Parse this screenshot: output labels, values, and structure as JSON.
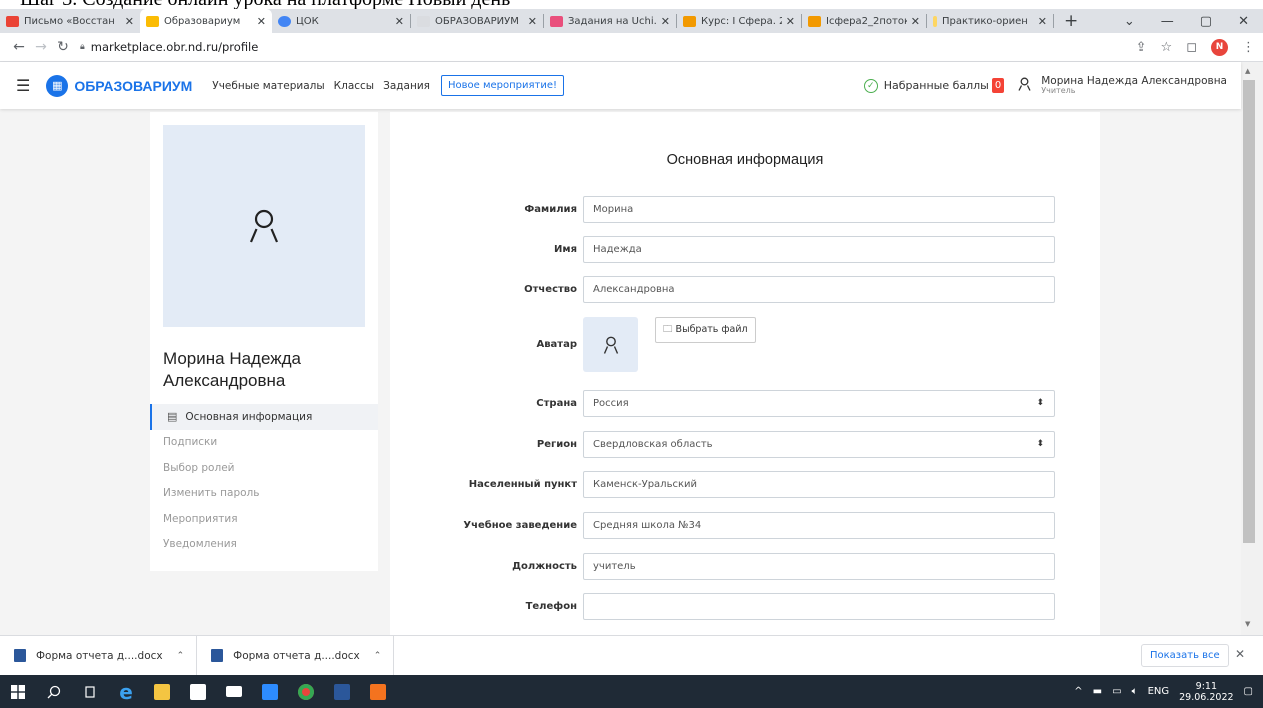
{
  "doc_strip_text": "Шаг 3. Создание онлайн урока на платформе Новый день",
  "tabs": [
    {
      "label": "Письмо «Восстан",
      "color": "#ea4335"
    },
    {
      "label": "Образовариум",
      "color": "#fbbc04",
      "active": true
    },
    {
      "label": "ЦОК",
      "color": "#4285f4"
    },
    {
      "label": "ОБРАЗОВАРИУМ",
      "color": "#9aa0a6"
    },
    {
      "label": "Задания на Uchi.",
      "color": "#e94f7c"
    },
    {
      "label": "Курс: I Сфера. 2",
      "color": "#f29900"
    },
    {
      "label": "Iсфера2_2поток:",
      "color": "#f29900"
    },
    {
      "label": "Практико-ориен",
      "color": "#fdd663"
    }
  ],
  "address": {
    "url": "marketplace.obr.nd.ru/profile",
    "profile_letter": "N"
  },
  "site": {
    "logo": "ОБРАЗОВАРИУМ",
    "nav": [
      "Учебные материалы",
      "Классы",
      "Задания"
    ],
    "new_event": "Новое мероприятие!",
    "score_label": "Набранные баллы",
    "score_value": "0",
    "user_name": "Морина Надежда Александровна",
    "user_role": "Учитель"
  },
  "profile": {
    "name": "Морина Надежда Александровна",
    "menu": [
      {
        "label": "Основная информация",
        "active": true
      },
      {
        "label": "Подписки"
      },
      {
        "label": "Выбор ролей"
      },
      {
        "label": "Изменить пароль"
      },
      {
        "label": "Мероприятия"
      },
      {
        "label": "Уведомления"
      }
    ]
  },
  "form": {
    "title": "Основная информация",
    "fields": {
      "surname": {
        "label": "Фамилия",
        "value": "Морина"
      },
      "name": {
        "label": "Имя",
        "value": "Надежда"
      },
      "patronymic": {
        "label": "Отчество",
        "value": "Александровна"
      },
      "avatar": {
        "label": "Аватар",
        "button": "Выбрать файл"
      },
      "country": {
        "label": "Страна",
        "value": "Россия"
      },
      "region": {
        "label": "Регион",
        "value": "Свердловская область"
      },
      "locality": {
        "label": "Населенный пункт",
        "value": "Каменск-Уральский"
      },
      "school": {
        "label": "Учебное заведение",
        "value": "Средняя школа №34"
      },
      "position": {
        "label": "Должность",
        "value": "учитель"
      },
      "phone": {
        "label": "Телефон",
        "value": ""
      }
    }
  },
  "downloads": {
    "items": [
      "Форма отчета д....docx",
      "Форма отчета д....docx"
    ],
    "show_all": "Показать все"
  },
  "taskbar": {
    "lang": "ENG",
    "time": "9:11",
    "date": "29.06.2022"
  }
}
